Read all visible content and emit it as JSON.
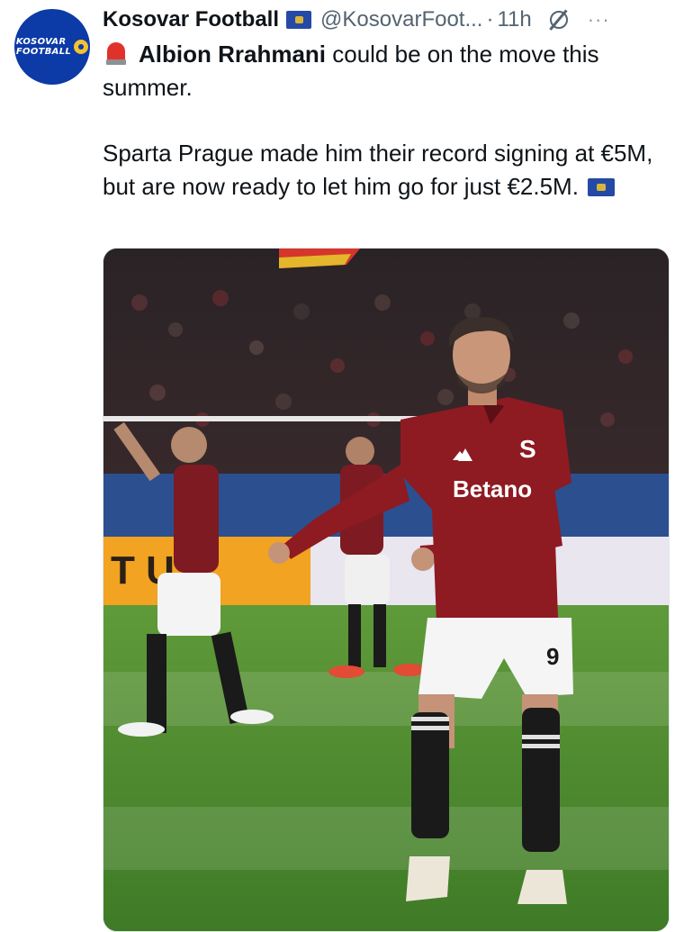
{
  "tweet": {
    "avatar_text_line1": "KOSOVAR",
    "avatar_text_line2": "FOOTBALL",
    "display_name": "Kosovar Football",
    "handle": "@KosovarFoot...",
    "separator": "·",
    "time": "11h",
    "more": "···",
    "player_name": "Albion Rrahmani",
    "line1_rest": " could be on the move this summer.",
    "line2": "Sparta Prague made him their record signing at €5M, but are now ready to let him go for just €2.5M.",
    "icons": {
      "verified_flag": "kosovo-flag-icon",
      "grok": "grok-icon",
      "more": "more-icon",
      "siren": "siren-icon",
      "inline_flag": "kosovo-flag-icon"
    }
  },
  "photo": {
    "sponsor": "Betano",
    "crest_letter": "S",
    "shirt_number": "9",
    "board_text": "T U",
    "colors": {
      "shirt": "#8e1a22",
      "pitch": "#4d8a2e",
      "board": "#f2a321"
    }
  }
}
